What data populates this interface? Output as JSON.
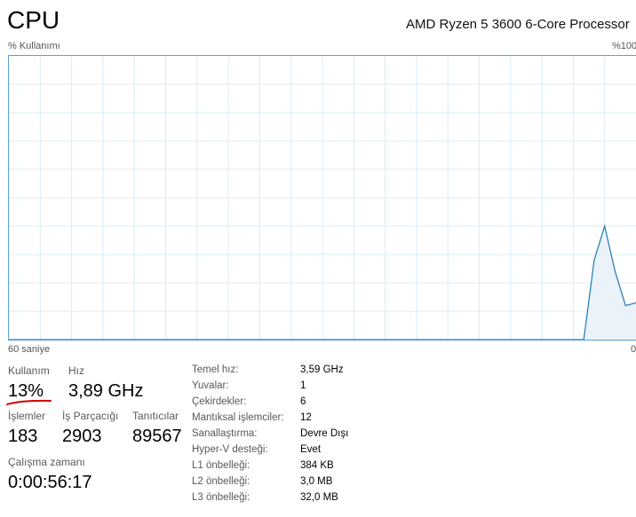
{
  "header": {
    "title": "CPU",
    "processor_name": "AMD Ryzen 5 3600 6-Core Processor"
  },
  "graph": {
    "usage_label": "% Kullanımı",
    "max_label": "%100",
    "time_label": "60 saniye",
    "min_label": "0",
    "line_color": "#1f78b4",
    "fill_color": "#eaf3fa",
    "grid_color": "#d9ebf6"
  },
  "stats": {
    "usage_label": "Kullanım",
    "usage_value": "13%",
    "speed_label": "Hız",
    "speed_value": "3,89 GHz",
    "processes_label": "İşlemler",
    "processes_value": "183",
    "threads_label": "İş Parçacığı",
    "threads_value": "2903",
    "handles_label": "Tanıtıcılar",
    "handles_value": "89567",
    "uptime_label": "Çalışma zamanı",
    "uptime_value": "0:00:56:17",
    "annotation_color": "#d40000"
  },
  "specs": [
    {
      "key": "Temel hız:",
      "value": "3,59 GHz"
    },
    {
      "key": "Yuvalar:",
      "value": "1"
    },
    {
      "key": "Çekirdekler:",
      "value": "6"
    },
    {
      "key": "Mantıksal işlemciler:",
      "value": "12"
    },
    {
      "key": "Sanallaştırma:",
      "value": "Devre Dışı"
    },
    {
      "key": "Hyper-V desteği:",
      "value": "Evet"
    },
    {
      "key": "L1 önbelleği:",
      "value": "384 KB"
    },
    {
      "key": "L2 önbelleği:",
      "value": "3,0 MB"
    },
    {
      "key": "L3 önbelleği:",
      "value": "32,0 MB"
    }
  ],
  "chart_data": {
    "type": "area",
    "x": [
      0,
      55,
      56,
      57,
      58,
      59,
      60
    ],
    "values": [
      0,
      0,
      28,
      40,
      24,
      12,
      13
    ],
    "ylim": [
      0,
      100
    ],
    "xlim": [
      0,
      60
    ],
    "grid": true
  }
}
